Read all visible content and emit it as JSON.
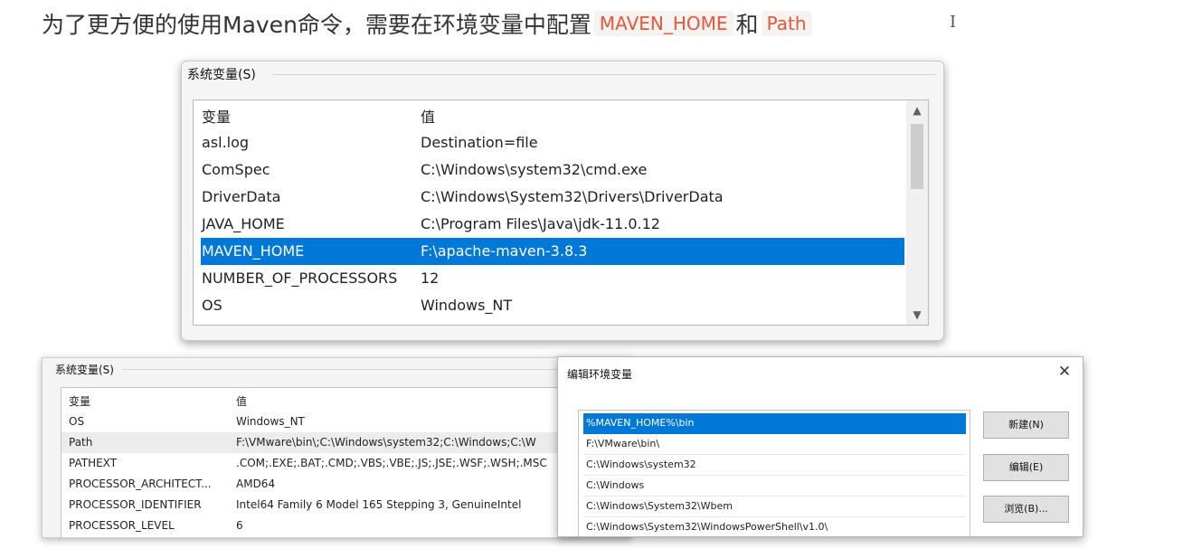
{
  "heading": {
    "prefix": "为了更方便的使用Maven命令，需要在环境变量中配置",
    "code1": "MAVEN_HOME",
    "conj": "和",
    "code2": "Path"
  },
  "cursor": "I",
  "top_dialog": {
    "group_label": "系统变量(S)",
    "col_var": "变量",
    "col_val": "值",
    "rows": [
      {
        "name": "asl.log",
        "value": "Destination=file"
      },
      {
        "name": "ComSpec",
        "value": "C:\\Windows\\system32\\cmd.exe"
      },
      {
        "name": "DriverData",
        "value": "C:\\Windows\\System32\\Drivers\\DriverData"
      },
      {
        "name": "JAVA_HOME",
        "value": "C:\\Program Files\\Java\\jdk-11.0.12"
      },
      {
        "name": "MAVEN_HOME",
        "value": "F:\\apache-maven-3.8.3"
      },
      {
        "name": "NUMBER_OF_PROCESSORS",
        "value": "12"
      },
      {
        "name": "OS",
        "value": "Windows_NT"
      }
    ],
    "selected_row": "MAVEN_HOME",
    "scroll_up": "▲",
    "scroll_down": "▼"
  },
  "bottom_left_dialog": {
    "group_label": "系统变量(S)",
    "col_var": "变量",
    "col_val": "值",
    "rows": [
      {
        "name": "OS",
        "value": "Windows_NT"
      },
      {
        "name": "Path",
        "value": "F:\\VMware\\bin\\;C:\\Windows\\system32;C:\\Windows;C:\\W"
      },
      {
        "name": "PATHEXT",
        "value": ".COM;.EXE;.BAT;.CMD;.VBS;.VBE;.JS;.JSE;.WSF;.WSH;.MSC"
      },
      {
        "name": "PROCESSOR_ARCHITECT...",
        "value": "AMD64"
      },
      {
        "name": "PROCESSOR_IDENTIFIER",
        "value": "Intel64 Family 6 Model 165 Stepping 3, GenuineIntel"
      },
      {
        "name": "PROCESSOR_LEVEL",
        "value": "6"
      }
    ],
    "highlighted_row": "Path"
  },
  "edit_dialog": {
    "title": "编辑环境变量",
    "close": "✕",
    "entries": [
      "%MAVEN_HOME%\\bin",
      "F:\\VMware\\bin\\",
      "C:\\Windows\\system32",
      "C:\\Windows",
      "C:\\Windows\\System32\\Wbem",
      "C:\\Windows\\System32\\WindowsPowerShell\\v1.0\\"
    ],
    "selected_entry": "%MAVEN_HOME%\\bin",
    "buttons": {
      "new": "新建(N)",
      "edit": "编辑(E)",
      "browse": "浏览(B)..."
    }
  },
  "colors": {
    "selection": "#0078d7",
    "code_text": "#e8563a"
  }
}
